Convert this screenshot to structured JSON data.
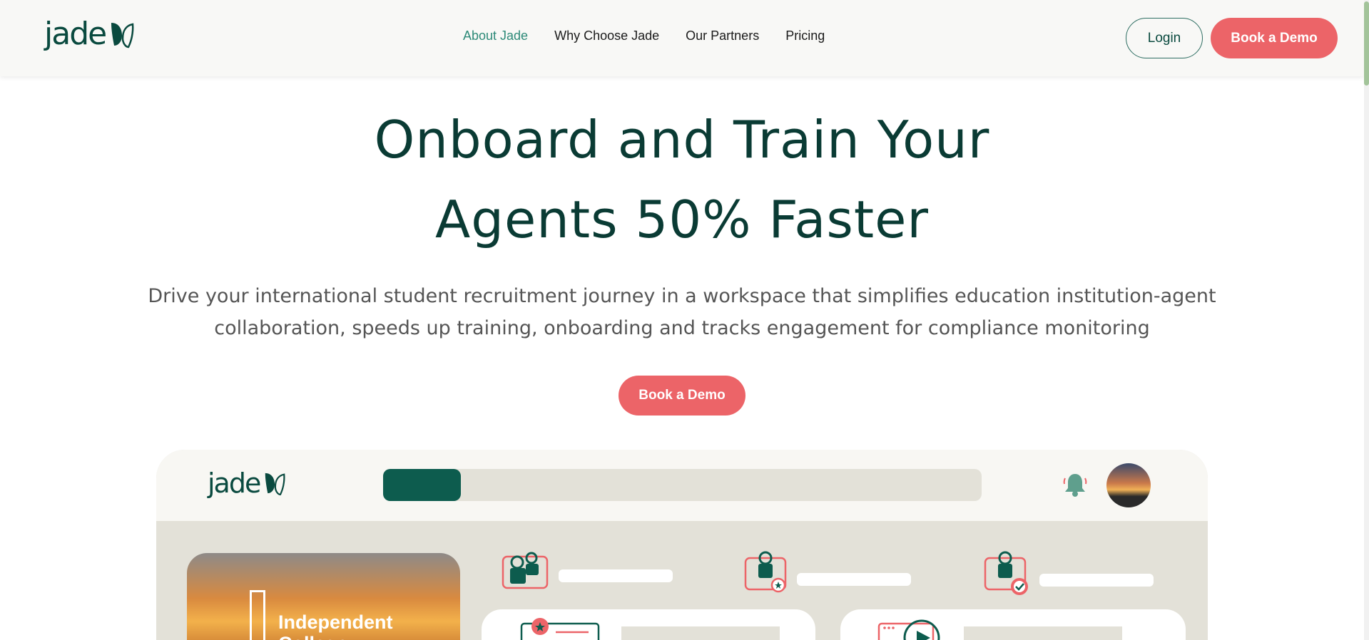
{
  "brand": {
    "logo_text": "jade",
    "accent": "#ec6468",
    "primary": "#0a3b34",
    "nav_active": "#2d8a78"
  },
  "nav": {
    "items": [
      {
        "label": "About Jade",
        "active": true
      },
      {
        "label": "Why Choose Jade",
        "active": false
      },
      {
        "label": "Our Partners",
        "active": false
      },
      {
        "label": "Pricing",
        "active": false
      }
    ]
  },
  "header": {
    "login_label": "Login",
    "demo_label": "Book a Demo"
  },
  "hero": {
    "title_line1": "Onboard and Train Your",
    "title_line2": "Agents 50% Faster",
    "subtitle_line1": "Drive your international student recruitment journey in a workspace that simplifies education institution-agent",
    "subtitle_line2": "collaboration, speeds up training, onboarding and tracks engagement for compliance monitoring",
    "cta_label": "Book a Demo"
  },
  "mockup": {
    "logo_text": "jade",
    "progress_fraction": 0.13,
    "college_name_line1": "Independent",
    "college_name_line2": "College",
    "icons": [
      "notification-bell-icon",
      "agents-group-icon",
      "agent-award-icon",
      "agent-verified-icon",
      "certificate-icon",
      "video-play-icon"
    ]
  }
}
